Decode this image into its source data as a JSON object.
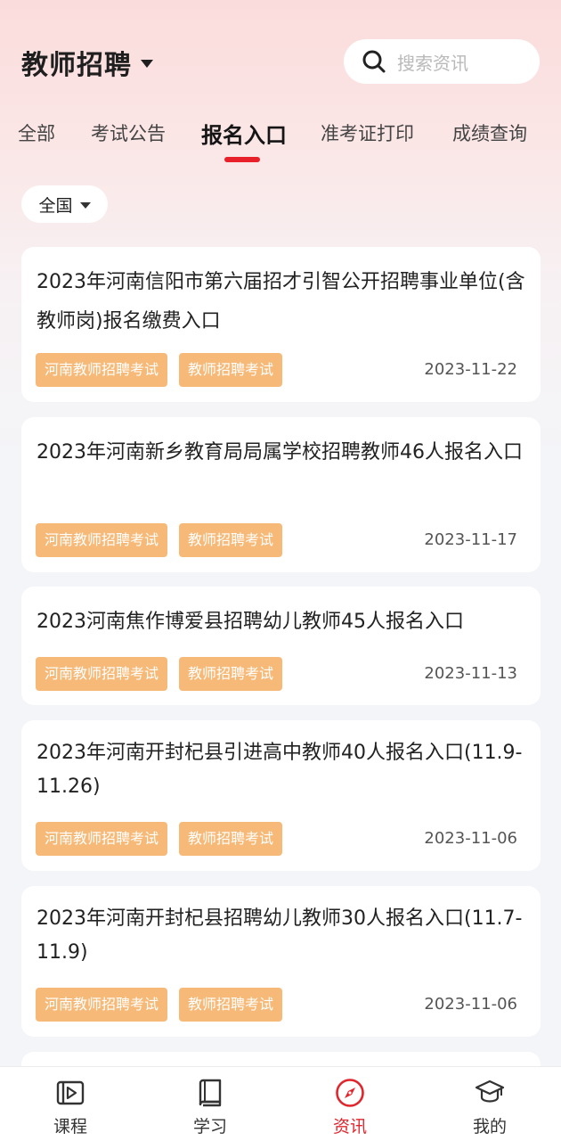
{
  "header": {
    "title": "教师招聘",
    "search_placeholder": "搜索资讯"
  },
  "tabs": [
    {
      "label": "全部",
      "active": false
    },
    {
      "label": "考试公告",
      "active": false
    },
    {
      "label": "报名入口",
      "active": true
    },
    {
      "label": "准考证打印",
      "active": false
    },
    {
      "label": "成绩查询",
      "active": false
    }
  ],
  "filter": {
    "region": "全国"
  },
  "articles": [
    {
      "title": "2023年河南信阳市第六届招才引智公开招聘事业单位(含教师岗)报名缴费入口",
      "tags": [
        "河南教师招聘考试",
        "教师招聘考试"
      ],
      "date": "2023-11-22"
    },
    {
      "title": "2023年河南新乡教育局局属学校招聘教师46人报名入口",
      "tags": [
        "河南教师招聘考试",
        "教师招聘考试"
      ],
      "date": "2023-11-17"
    },
    {
      "title": "2023河南焦作博爱县招聘幼儿教师45人报名入口",
      "tags": [
        "河南教师招聘考试",
        "教师招聘考试"
      ],
      "date": "2023-11-13"
    },
    {
      "title": "2023年河南开封杞县引进高中教师40人报名入口(11.9-11.26)",
      "tags": [
        "河南教师招聘考试",
        "教师招聘考试"
      ],
      "date": "2023-11-06"
    },
    {
      "title": "2023年河南开封杞县招聘幼儿教师30人报名入口(11.7-11.9)",
      "tags": [
        "河南教师招聘考试",
        "教师招聘考试"
      ],
      "date": "2023-11-06"
    }
  ],
  "tabbar": [
    {
      "label": "课程",
      "icon": "video-icon",
      "active": false
    },
    {
      "label": "学习",
      "icon": "book-icon",
      "active": false
    },
    {
      "label": "资讯",
      "icon": "compass-icon",
      "active": true
    },
    {
      "label": "我的",
      "icon": "graduation-cap-icon",
      "active": false
    }
  ],
  "colors": {
    "accent": "#e8202a",
    "tag_bg": "#f7b977",
    "tab_active": "#e0262c"
  }
}
